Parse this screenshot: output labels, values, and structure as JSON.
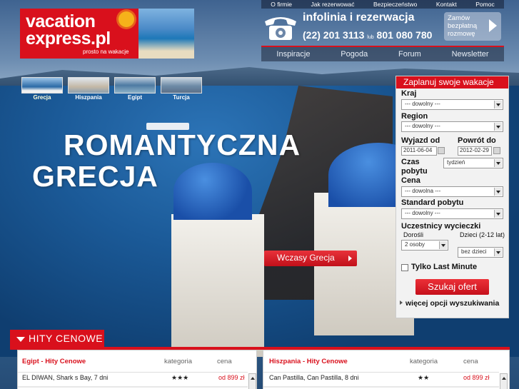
{
  "logo": {
    "line1": "vacation",
    "line2": "express.pl",
    "tagline": "prosto na wakacje",
    "brand_color": "#d9101c"
  },
  "top_nav": [
    "O firmie",
    "Jak rezerwować",
    "Bezpieczeństwo",
    "Kontakt",
    "Pomoc"
  ],
  "contact": {
    "title": "infolinia i rezerwacja",
    "phone1": "(22) 201 3113",
    "or": "lub",
    "phone2": "801 080 780",
    "callback_label": "Zamów bezpłatną rozmowę"
  },
  "main_nav": [
    "Inspiracje",
    "Pogoda",
    "Forum",
    "Newsletter"
  ],
  "destinations": [
    {
      "label": "Grecja",
      "active": true
    },
    {
      "label": "Hiszpania",
      "active": false
    },
    {
      "label": "Egipt",
      "active": false
    },
    {
      "label": "Turcja",
      "active": false
    }
  ],
  "hero": {
    "line1": "ROMANTYCZNA",
    "line2": "GRECJA",
    "cta": "Wczasy Grecja"
  },
  "search": {
    "title": "Zaplanuj swoje wakacje",
    "country_label": "Kraj",
    "country_value": "--- dowolny ---",
    "region_label": "Region",
    "region_value": "--- dowolny ---",
    "depart_label": "Wyjazd od",
    "depart_value": "2011-06-04",
    "return_label": "Powrót do",
    "return_value": "2012-02-29",
    "duration_label_1": "Czas",
    "duration_label_2": "pobytu",
    "duration_value": "tydzień",
    "price_label": "Cena",
    "price_value": "--- dowolna ---",
    "standard_label": "Standard pobytu",
    "standard_value": "--- dowolny ---",
    "participants_label": "Uczestnicy wycieczki",
    "adults_label": "Dorośli",
    "adults_value": "2 osoby",
    "children_label": "Dzieci (2-12 lat)",
    "children_value": "bez dzieci",
    "last_minute_label": "Tylko Last Minute",
    "search_button": "Szukaj ofert",
    "more_options": "więcej opcji wyszukiwania"
  },
  "hits": {
    "tab_label": "HITY CENOWE",
    "boxes": [
      {
        "title": "Egipt - Hity Cenowe",
        "col_category": "kategoria",
        "col_price": "cena",
        "rows": [
          {
            "name": "EL DIWAN, Shark s Bay, 7 dni",
            "stars": "★★★",
            "price": "od 899 zł"
          }
        ]
      },
      {
        "title": "Hiszpania - Hity Cenowe",
        "col_category": "kategoria",
        "col_price": "cena",
        "rows": [
          {
            "name": "Can Pastilla, Can Pastilla, 8 dni",
            "stars": "★★",
            "price": "od 899 zł"
          }
        ]
      }
    ]
  }
}
